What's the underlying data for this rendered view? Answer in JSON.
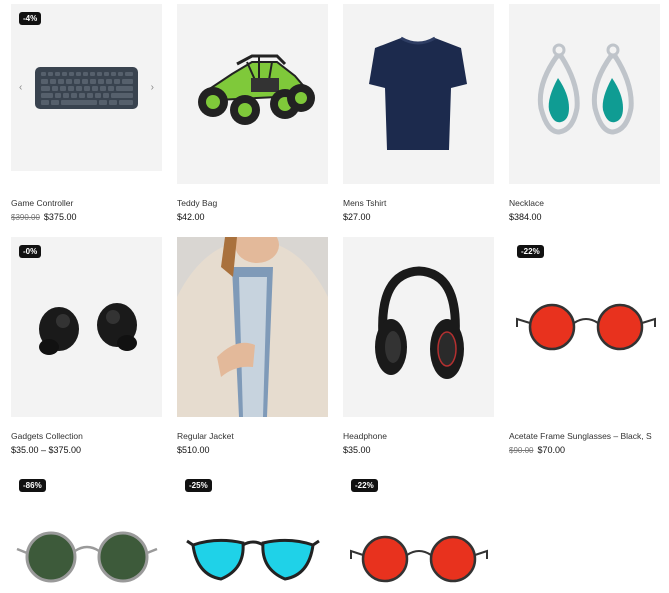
{
  "products": [
    {
      "name": "Game Controller",
      "old_price": "$390.00",
      "price": "$375.00",
      "badge": "-4%",
      "icon": "keyboard-icon",
      "has_arrows": true,
      "prev": "‹",
      "next": "›"
    },
    {
      "name": "Teddy Bag",
      "price": "$42.00",
      "icon": "rc-buggy-icon"
    },
    {
      "name": "Mens Tshirt",
      "price": "$27.00",
      "icon": "tshirt-icon"
    },
    {
      "name": "Necklace",
      "price": "$384.00",
      "icon": "earrings-icon"
    },
    {
      "name": "Gadgets Collection",
      "price": "$35.00 – $375.00",
      "badge": "-0%",
      "icon": "earbuds-icon"
    },
    {
      "name": "Regular Jacket",
      "price": "$510.00",
      "icon": "jacket-icon"
    },
    {
      "name": "Headphone",
      "price": "$35.00",
      "icon": "headphone-icon"
    },
    {
      "name": "Acetate Frame Sunglasses – Black, S",
      "old_price": "$90.00",
      "price": "$70.00",
      "badge": "-22%",
      "icon": "red-round-sunglasses-icon"
    },
    {
      "badge": "-86%",
      "icon": "green-round-sunglasses-icon"
    },
    {
      "badge": "-25%",
      "icon": "blue-mirror-sunglasses-icon"
    },
    {
      "badge": "-22%",
      "icon": "red-round-sunglasses-icon"
    }
  ],
  "colors": {
    "badge_bg": "#111111",
    "image_bg": "#f3f3f3",
    "accent_red": "#e8321e",
    "accent_cyan": "#1fd2e8",
    "lens_green": "#3d5a3a"
  }
}
